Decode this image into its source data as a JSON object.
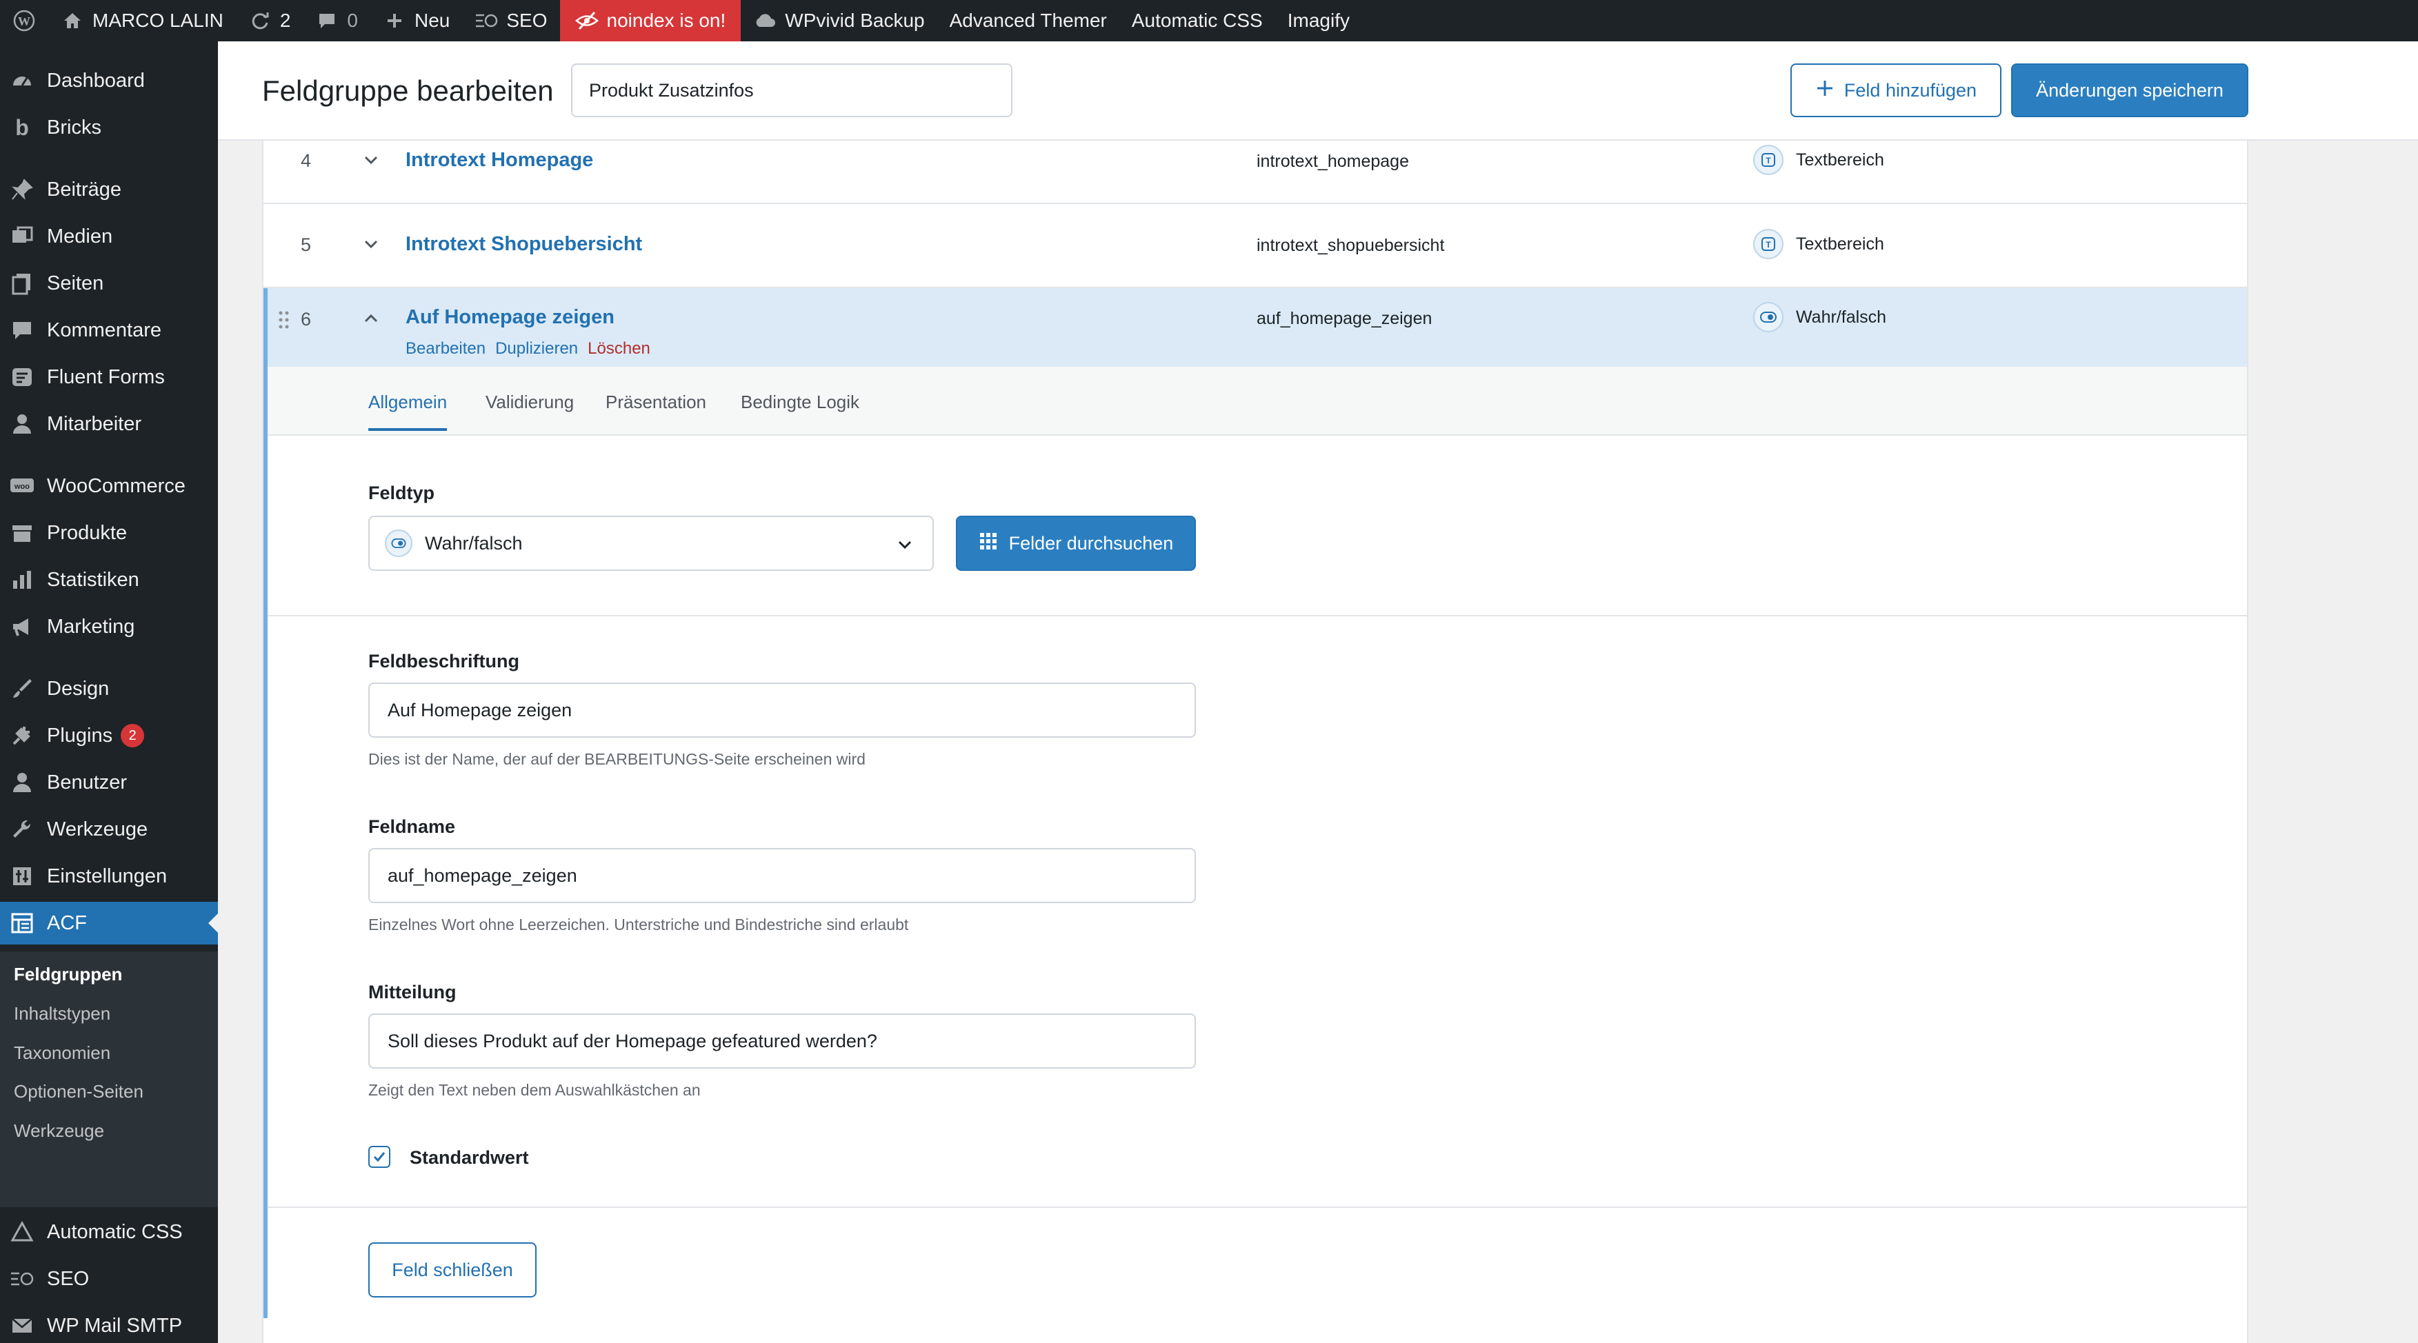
{
  "adminbar": {
    "site_name": "MARCO LALIN",
    "updates_count": "2",
    "comments_count": "0",
    "new_label": "Neu",
    "seo_label": "SEO",
    "noindex_label": "noindex is on!",
    "backup_label": "WPvivid Backup",
    "themer_label": "Advanced Themer",
    "acss_label": "Automatic CSS",
    "imagify_label": "Imagify"
  },
  "sidebar": {
    "items": [
      {
        "label": "Dashboard",
        "icon": "dashboard-icon"
      },
      {
        "label": "Bricks",
        "icon": "bricks-icon"
      },
      {
        "label": "Beiträge",
        "icon": "pin-icon"
      },
      {
        "label": "Medien",
        "icon": "media-icon"
      },
      {
        "label": "Seiten",
        "icon": "pages-icon"
      },
      {
        "label": "Kommentare",
        "icon": "comments-icon"
      },
      {
        "label": "Fluent Forms",
        "icon": "forms-icon"
      },
      {
        "label": "Mitarbeiter",
        "icon": "user-icon"
      },
      {
        "label": "WooCommerce",
        "icon": "woo-icon"
      },
      {
        "label": "Produkte",
        "icon": "products-icon"
      },
      {
        "label": "Statistiken",
        "icon": "stats-icon"
      },
      {
        "label": "Marketing",
        "icon": "megaphone-icon"
      },
      {
        "label": "Design",
        "icon": "brush-icon"
      },
      {
        "label": "Plugins",
        "icon": "plugin-icon",
        "badge": "2"
      },
      {
        "label": "Benutzer",
        "icon": "users-icon"
      },
      {
        "label": "Werkzeuge",
        "icon": "wrench-icon"
      },
      {
        "label": "Einstellungen",
        "icon": "settings-icon"
      },
      {
        "label": "ACF",
        "icon": "acf-icon"
      }
    ],
    "submenu": [
      "Feldgruppen",
      "Inhaltstypen",
      "Taxonomien",
      "Optionen-Seiten",
      "Werkzeuge"
    ],
    "after": [
      {
        "label": "Automatic CSS",
        "icon": "acss-icon"
      },
      {
        "label": "SEO",
        "icon": "seo-icon"
      },
      {
        "label": "WP Mail SMTP",
        "icon": "mail-icon"
      }
    ]
  },
  "header": {
    "title": "Feldgruppe bearbeiten",
    "group_name": "Produkt Zusatzinfos",
    "add_field_label": "Feld hinzufügen",
    "save_label": "Änderungen speichern"
  },
  "fields": [
    {
      "order": "4",
      "label": "Introtext Homepage",
      "name": "introtext_homepage",
      "type": "Textbereich"
    },
    {
      "order": "5",
      "label": "Introtext Shopuebersicht",
      "name": "introtext_shopuebersicht",
      "type": "Textbereich"
    },
    {
      "order": "6",
      "label": "Auf Homepage zeigen",
      "name": "auf_homepage_zeigen",
      "type": "Wahr/falsch"
    }
  ],
  "row_actions": {
    "edit": "Bearbeiten",
    "duplicate": "Duplizieren",
    "delete": "Löschen"
  },
  "tabs": [
    "Allgemein",
    "Validierung",
    "Präsentation",
    "Bedingte Logik"
  ],
  "settings": {
    "field_type_label": "Feldtyp",
    "field_type_value": "Wahr/falsch",
    "browse_label": "Felder durchsuchen",
    "label_label": "Feldbeschriftung",
    "label_value": "Auf Homepage zeigen",
    "label_help": "Dies ist der Name, der auf der BEARBEITUNGS-Seite erscheinen wird",
    "name_label": "Feldname",
    "name_value": "auf_homepage_zeigen",
    "name_help": "Einzelnes Wort ohne Leerzeichen. Unterstriche und Bindestriche sind erlaubt",
    "message_label": "Mitteilung",
    "message_value": "Soll dieses Produkt auf der Homepage gefeatured werden?",
    "message_help": "Zeigt den Text neben dem Auswahlkästchen an",
    "default_label": "Standardwert",
    "default_checked": true,
    "close_label": "Feld schließen"
  },
  "colors": {
    "accent": "#2271b1",
    "adminbar": "#1d2327",
    "danger": "#d63638",
    "open_row": "#dbeaf6"
  }
}
